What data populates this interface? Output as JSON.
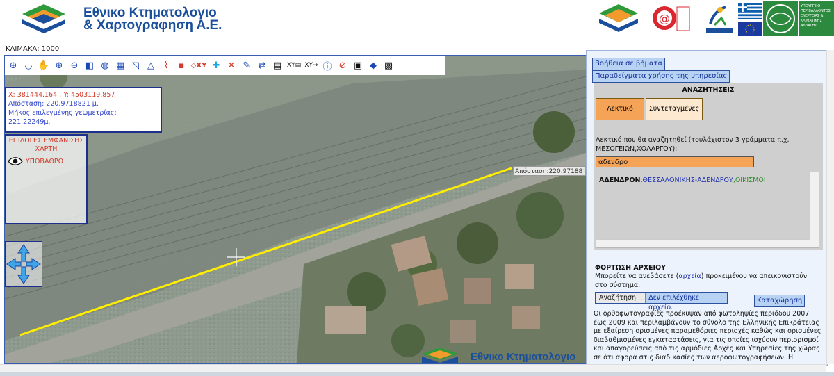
{
  "header": {
    "logo_line1": "Εθνικο Κτηματολογιο",
    "logo_line2": "& Χαρτογραφηση Α.Ε.",
    "partner_text": "ΥΠΟΥΡΓΕΙΟ ΠΕΡΙΒΑΛΛΟΝΤΟΣ ΕΝΕΡΓΕΙΑΣ & ΚΛΙΜΑΤΙΚΗΣ ΑΛΛΑΓΗΣ",
    "partner_small": "ΕΣΠΑ 2007-2013 2008",
    "colors": {
      "brand_blue": "#1b4f9c",
      "brand_green": "#2f9a3a",
      "brand_orange": "#f29b2c"
    }
  },
  "scale_label": "ΚΛΙΜΑΚΑ: 1000",
  "toolbar": {
    "tools": [
      "identify-icon",
      "undo-icon",
      "pan-hand-icon",
      "zoom-in-icon",
      "zoom-out-icon",
      "previous-extent-icon",
      "globe-icon",
      "measure-area-icon",
      "polygon-icon",
      "distance-icon",
      "polyline-icon",
      "point-icon",
      "clear-xy-icon",
      "select-icon",
      "delete-icon",
      "draw-icon",
      "refresh-icon",
      "table-icon",
      "xy-table-icon",
      "xy-go-icon",
      "info-icon",
      "no-select-icon",
      "print-icon",
      "fill-icon",
      "layer-icon"
    ]
  },
  "coords": {
    "xy": "X: 381444.164 , Y: 4503119.857",
    "distance": "Απόσταση: 220.9718821 μ.",
    "length": "Μήκος επιλεγμένης γεωμετρίας: 221.22249μ."
  },
  "layers": {
    "title": "ΕΠΙΛΟΓΕΣ ΕΜΦΑΝΙΣΗΣ ΧΑΡΤΗ",
    "item": "ΥΠΟΒΑΘΡΟ"
  },
  "measure_label": "Απόσταση:220.97188",
  "watermark_text": "Εθνικο Κτηματολογιο",
  "panel": {
    "help_button": "Βοήθεια σε βήματα",
    "examples_button": "Παραδείγματα χρήσης της υπηρεσίας",
    "search_title": "ΑΝΑΖΗΤΗΣΕΙΣ",
    "tab_text": "Λεκτικό",
    "tab_coords": "Συντεταγμένες",
    "hint": "Λεκτικό που θα αναζητηθεί (τουλάχιστον 3 γράμματα π.χ. ΜΕΣΟΓΕΙΩΝ,ΧΟΛΑΡΓΟΥ):",
    "search_value": "αδενδρο",
    "result_bold": "ΑΔΕΝΔΡΟΝ",
    "result_blue": ",ΘΕΣΣΑΛΟΝΙΚΗΣ-ΑΔΕΝΔΡΟΥ",
    "result_green": ",ΟΙΚΙΣΜΟΙ",
    "file_title": "ΦΟΡΤΩΣΗ ΑΡΧΕΙΟΥ",
    "file_desc_pre": "Μπορείτε να ανεβάσετε (",
    "file_desc_link": "αρχεία",
    "file_desc_post": ") προκειμένου να απεικονιστούν στο σύστημα.",
    "browse_button": "Αναζήτηση...",
    "no_file": "Δεν επιλέχθηκε αρχείο.",
    "submit_button": "Καταχώρηση",
    "info_text": "Οι ορθοφωτογραφίες προέκυψαν από φωτοληψίες περιόδου 2007 έως 2009 και περιλαμβάνουν το σύνολο της Ελληνικής Επικράτειας με εξαίρεση ορισμένες παραμεθόριες περιοχές καθώς και ορισμένες διαβαθμισμένες εγκαταστάσεις, για τις οποίες ισχύουν περιορισμοί και απαγορεύσεις από τις αρμόδιες Αρχές και Υπηρεσίες της χώρας σε ότι αφορά στις διαδικασίες των αεροφωτογραφήσεων. Η"
  }
}
